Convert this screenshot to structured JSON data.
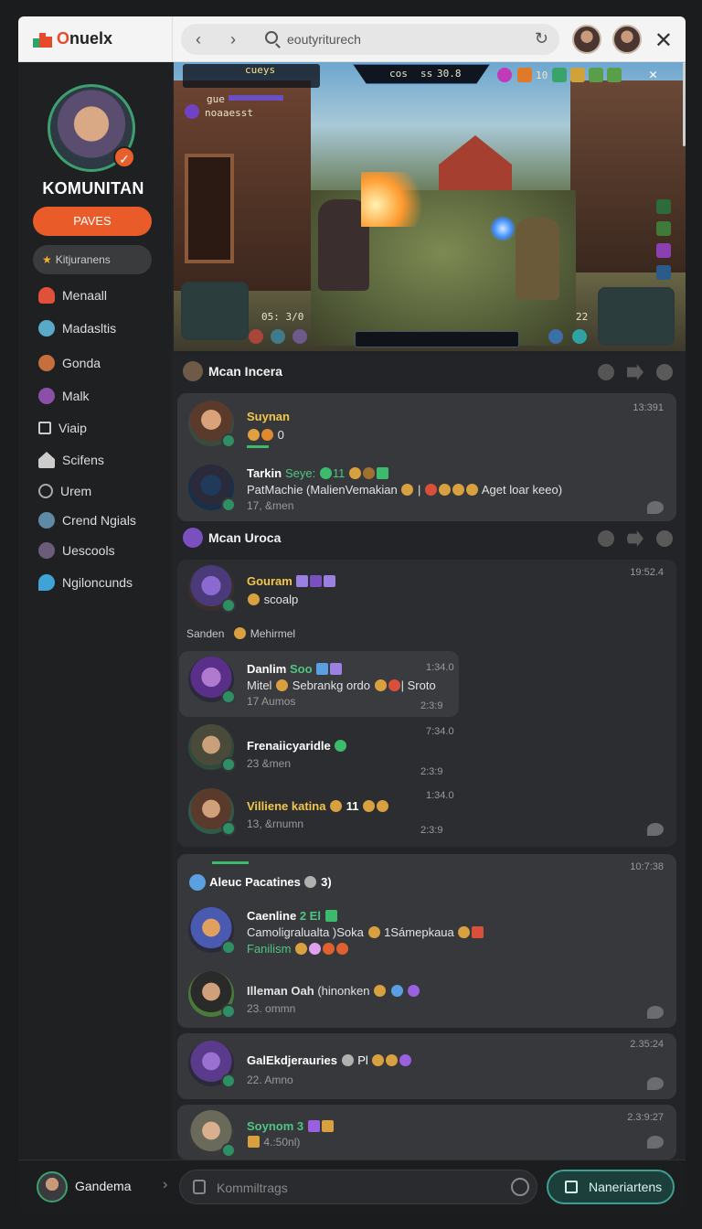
{
  "app": {
    "logo_text_1": "O",
    "logo_text_2": "nuelx"
  },
  "browser": {
    "url": "eoutyriturech",
    "back": "‹",
    "forward": "›",
    "reload": "↻",
    "close": "✕"
  },
  "sidebar": {
    "profile_name": "KOMUNITAN",
    "primary_button": "PAVES",
    "search_label": "Kitjuranens",
    "items": [
      {
        "label": "Menaall",
        "color": "#e0503a"
      },
      {
        "label": "Madasltis",
        "color": "#5aa9c8"
      },
      {
        "label": "Gonda",
        "color": "#c46f3d"
      },
      {
        "label": "Malk",
        "color": "#8c4fa8"
      },
      {
        "label": "Viaip",
        "color": "#cccccc"
      },
      {
        "label": "Scifens",
        "color": "#cccccc"
      },
      {
        "label": "Urem",
        "color": "#aaaaaa"
      },
      {
        "label": "Crend Ngials",
        "color": "#5f8aa6"
      },
      {
        "label": "Uescools",
        "color": "#6b5d7a"
      },
      {
        "label": "Ngiloncunds",
        "color": "#3fa3d6"
      }
    ],
    "footer_user": "Gandema"
  },
  "game": {
    "hud_left_top": "cueys",
    "hud_left_label": "gue",
    "hud_left_sub": "noaaesst",
    "hud_center_a": "cos",
    "hud_center_b": "ss",
    "hud_center_c": "30.8",
    "hud_right": "10",
    "score": "05: 3/0",
    "count_right": "22"
  },
  "feed": {
    "section1": {
      "title": "Mcan Incera"
    },
    "post1": {
      "user": "Suynan",
      "sub": "0",
      "time": "13:391",
      "reply_user": "Tarkin",
      "reply_tag": "Seye:",
      "reply_num": "11",
      "reply_text": "PatMachie (MalienVemakian",
      "reply_tail": "Aget loar keeo)",
      "reply_meta": "17, &men"
    },
    "section2": {
      "title": "Mcan Uroca"
    },
    "post2": {
      "user": "Gouram",
      "sub": "scoalp",
      "time": "19:52.4",
      "thread_a": "Sanden",
      "thread_b": "Mehirmel",
      "n1_user": "Danlim",
      "n1_tag": "Soo",
      "n1_text": "Mitel",
      "n1_text2": "Sebrankg ordo",
      "n1_text3": "| Sroto",
      "n1_meta": "17 Aumos",
      "n1_time": "1:34.0",
      "n1_time2": "2:3:9",
      "n2_user": "Frenaiicyaridle",
      "n2_meta": "23 &men",
      "n2_time": "7:34.0",
      "n2_time2": "2:3:9",
      "n3_user": "Villiene katina",
      "n3_num": "11",
      "n3_meta": "13, &rnumn",
      "n3_time": "1:34.0",
      "n3_time2": "2:3:9"
    },
    "post3": {
      "user": "Aleuc Pacatines",
      "sub": "3)",
      "time": "10:7:38",
      "c1_user": "Caenline",
      "c1_tag": "2 El",
      "c1_text": "Camoligralualta )Soka",
      "c1_text2": "1Sámepkaua",
      "c1_line2": "Fanilism",
      "c2_user": "Illeman Oah",
      "c2_text": "(hinonken",
      "c2_meta": "23. ommn"
    },
    "post4": {
      "user": "GalEkdjerauries",
      "tag": "Pl",
      "meta": "22. Amno",
      "time": "2.35:24"
    },
    "post5": {
      "user": "Soynom",
      "tag": "3",
      "meta": "4.:50nl)",
      "time": "2.3:9:27"
    }
  },
  "composer": {
    "placeholder": "Kommiltrags",
    "send_label": "Naneriartens"
  },
  "colors": {
    "accent": "#ea5b2a",
    "green": "#3da06e",
    "teal": "#3e9e92"
  }
}
